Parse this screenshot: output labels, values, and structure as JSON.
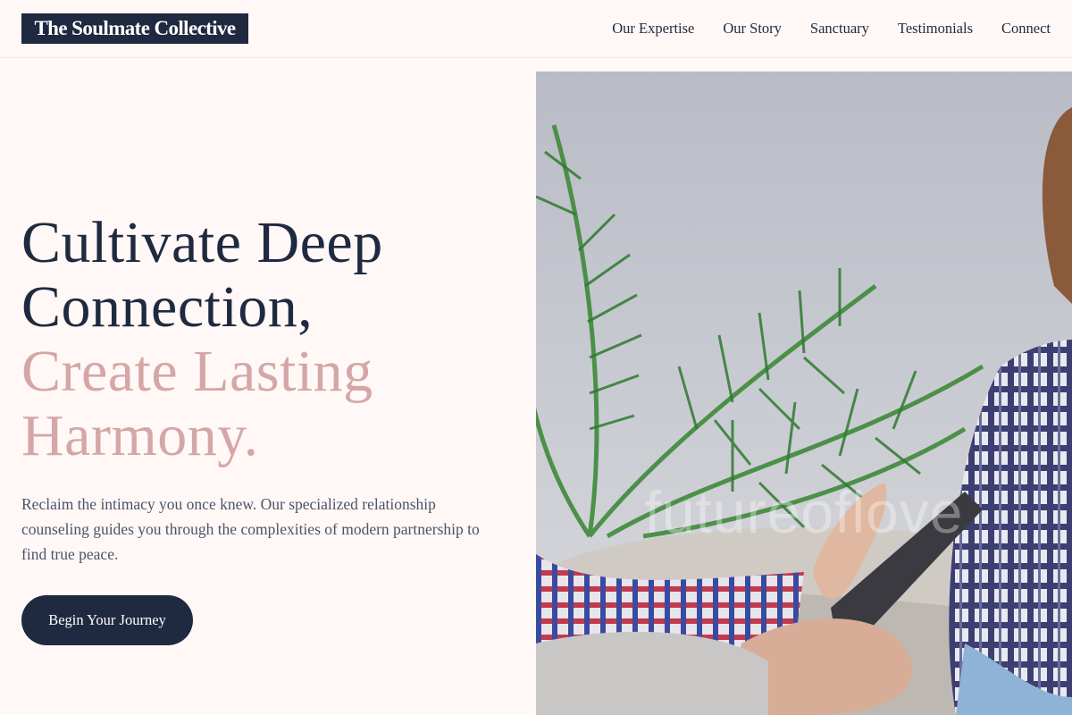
{
  "header": {
    "brand": "The Soulmate Collective",
    "nav": [
      "Our Expertise",
      "Our Story",
      "Sanctuary",
      "Testimonials",
      "Connect"
    ]
  },
  "hero": {
    "headline_line1": "Cultivate Deep",
    "headline_line2": "Connection,",
    "headline_line3": "Create Lasting",
    "headline_line4": "Harmony.",
    "lead": "Reclaim the intimacy you once knew. Our specialized relationship counseling guides you through the complexities of modern partnership to find true peace.",
    "cta_label": "Begin Your Journey",
    "image_watermark": "futureoflove"
  },
  "colors": {
    "navy": "#1f2a40",
    "blush": "#d4a7a6",
    "background": "#fff8f7",
    "body_text": "#4a5468"
  }
}
